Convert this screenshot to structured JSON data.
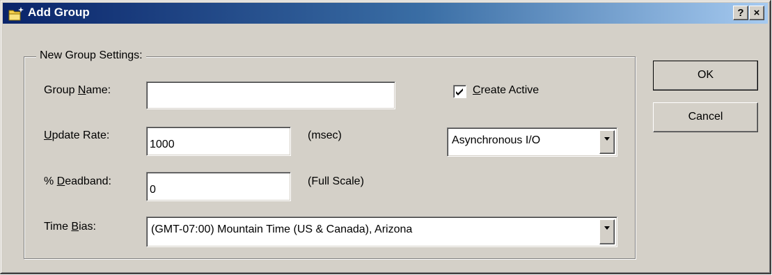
{
  "window": {
    "title": "Add Group",
    "help_label": "?",
    "close_label": "×"
  },
  "group_settings": {
    "legend": "New Group Settings:",
    "group_name": {
      "label_pre": "Group ",
      "label_key": "N",
      "label_post": "ame:",
      "value": ""
    },
    "update_rate": {
      "label_pre": "",
      "label_key": "U",
      "label_post": "pdate Rate:",
      "value": "1000",
      "unit": "(msec)"
    },
    "deadband": {
      "label_pre": "% ",
      "label_key": "D",
      "label_post": "eadband:",
      "value": "0",
      "unit": "(Full Scale)"
    },
    "time_bias": {
      "label_pre": "Time ",
      "label_key": "B",
      "label_post": "ias:",
      "selected": "(GMT-07:00) Mountain Time (US & Canada), Arizona"
    },
    "create_active": {
      "label_pre": "",
      "label_key": "C",
      "label_post": "reate Active",
      "checked": true
    },
    "io_mode": {
      "selected": "Asynchronous I/O"
    }
  },
  "buttons": {
    "ok": "OK",
    "cancel": "Cancel"
  },
  "colors": {
    "dialog_face": "#d4d0c8",
    "titlebar_start": "#0a246a",
    "titlebar_end": "#a6caf0"
  },
  "icons": {
    "app": "folder-sparkle-icon",
    "help": "help-icon",
    "close": "close-icon",
    "dropdown": "chevron-down-icon",
    "check": "check-icon"
  }
}
